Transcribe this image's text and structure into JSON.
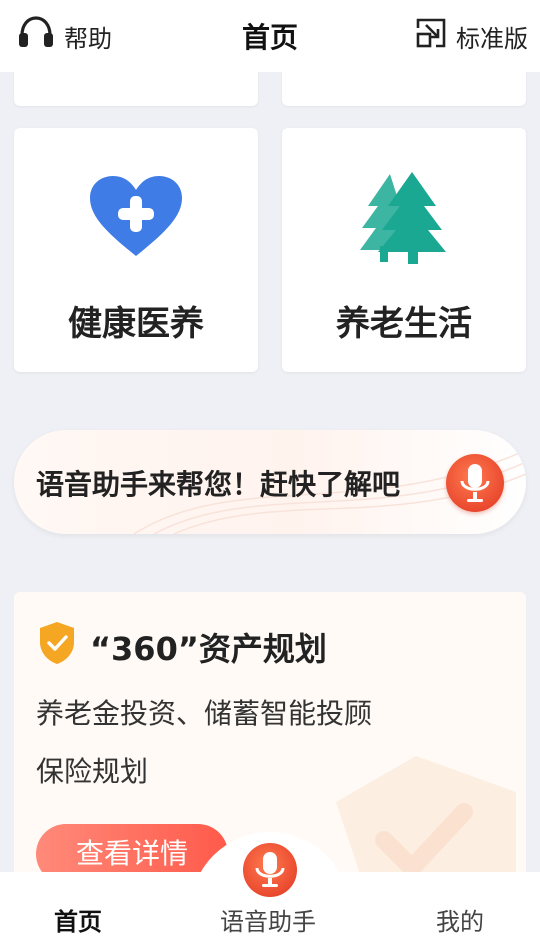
{
  "header": {
    "help_label": "帮助",
    "title": "首页",
    "mode_label": "标准版",
    "help_icon": "headset-icon",
    "mode_icon": "switch-mode-icon"
  },
  "services": [
    {
      "label": "健康医养",
      "icon": "heart-plus-icon",
      "color": "#3f7ce6"
    },
    {
      "label": "养老生活",
      "icon": "pine-trees-icon",
      "color": "#1aa892"
    }
  ],
  "voice_banner": {
    "text": "语音助手来帮您！赶快了解吧",
    "icon": "microphone-icon"
  },
  "asset_card": {
    "title": "“360”资产规划",
    "line1": "养老金投资、储蓄智能投顾",
    "line2": "保险规划",
    "button_label": "查看详情",
    "badge_icon": "shield-check-icon",
    "badge_color": "#f5a623"
  },
  "tabbar": {
    "tabs": [
      {
        "label": "首页",
        "active": true
      },
      {
        "label": "语音助手",
        "active": false
      },
      {
        "label": "我的",
        "active": false
      }
    ],
    "center_icon": "microphone-icon"
  }
}
